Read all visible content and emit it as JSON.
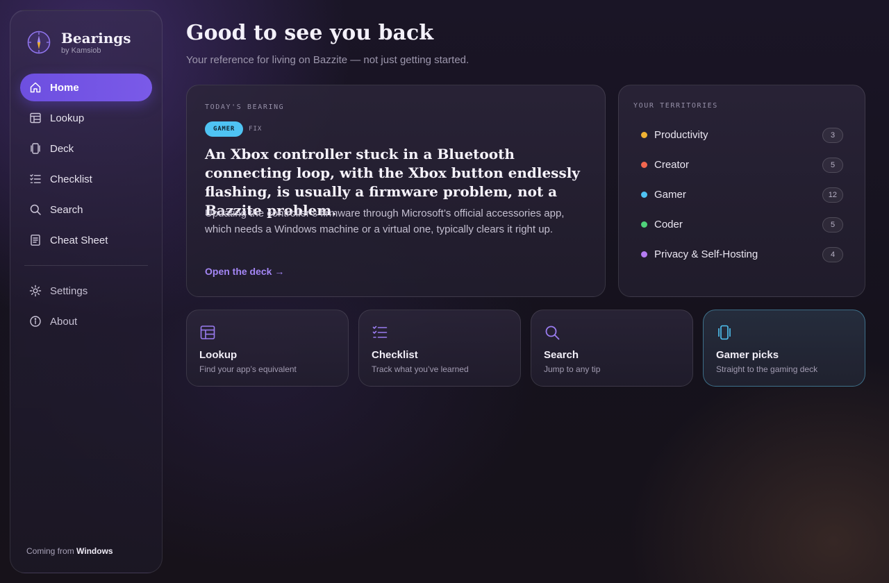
{
  "brand": {
    "name": "Bearings",
    "subtitle": "by Kamsiob"
  },
  "nav": {
    "primary": [
      {
        "label": "Home",
        "icon": "home-icon",
        "active": true
      },
      {
        "label": "Lookup",
        "icon": "table-icon"
      },
      {
        "label": "Deck",
        "icon": "deck-icon"
      },
      {
        "label": "Checklist",
        "icon": "checklist-icon"
      },
      {
        "label": "Search",
        "icon": "search-icon"
      },
      {
        "label": "Cheat Sheet",
        "icon": "document-icon"
      }
    ],
    "secondary": [
      {
        "label": "Settings",
        "icon": "gear-icon"
      },
      {
        "label": "About",
        "icon": "info-icon"
      }
    ]
  },
  "footer": {
    "prefix": "Coming from",
    "os": "Windows"
  },
  "header": {
    "title": "Good to see you back",
    "subtitle": "Your reference for living on Bazzite — not just getting started."
  },
  "bearing": {
    "eyebrow": "TODAY'S BEARING",
    "tag": "GAMER",
    "kind": "FIX",
    "title": "An Xbox controller stuck in a Bluetooth connecting loop, with the Xbox button endlessly flashing, is usually a firmware problem, not a Bazzite problem.",
    "body": "Updating the controller’s firmware through Microsoft’s official accessories app, which needs a Windows machine or a virtual one, typically clears it right up.",
    "link": "Open the deck →"
  },
  "territories": {
    "eyebrow": "YOUR TERRITORIES",
    "items": [
      {
        "label": "Productivity",
        "count": "3",
        "color": "#f0b233"
      },
      {
        "label": "Creator",
        "count": "5",
        "color": "#f2674f"
      },
      {
        "label": "Gamer",
        "count": "12",
        "color": "#4fc3f3"
      },
      {
        "label": "Coder",
        "count": "5",
        "color": "#4fd27a"
      },
      {
        "label": "Privacy & Self-Hosting",
        "count": "4",
        "color": "#b57cf2"
      }
    ]
  },
  "quick": [
    {
      "title": "Lookup",
      "subtitle": "Find your app’s equivalent",
      "icon": "table-icon"
    },
    {
      "title": "Checklist",
      "subtitle": "Track what you’ve learned",
      "icon": "checklist-icon"
    },
    {
      "title": "Search",
      "subtitle": "Jump to any tip",
      "icon": "search-icon"
    },
    {
      "title": "Gamer picks",
      "subtitle": "Straight to the gaming deck",
      "icon": "deck-icon"
    }
  ]
}
